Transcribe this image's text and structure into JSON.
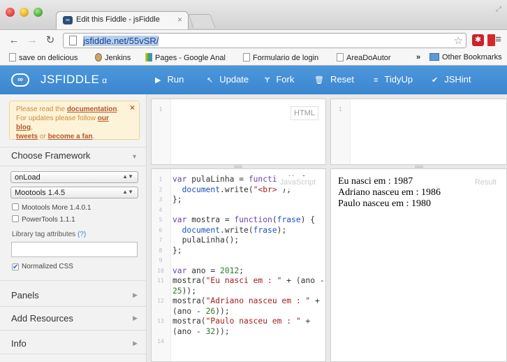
{
  "browser": {
    "tab_title": "Edit this Fiddle - jsFiddle",
    "tab_close": "×",
    "url_host": "jsfiddle.net",
    "url_path": "/55vSR/",
    "bookmarks": [
      "save on delicious",
      "Jenkins",
      "Pages - Google Anal",
      "Formulario de login",
      "AreaDoAutor"
    ],
    "bookmarks_overflow": "»",
    "other_bookmarks": "Other Bookmarks"
  },
  "header": {
    "logo": "JSFIDDLE",
    "logo_suffix": "α",
    "buttons": [
      {
        "label": "Run",
        "icon": "▶"
      },
      {
        "label": "Update",
        "icon": "↖"
      },
      {
        "label": "Fork",
        "icon": "Ɏ"
      },
      {
        "label": "Reset",
        "icon": "🗑"
      },
      {
        "label": "TidyUp",
        "icon": "≡"
      },
      {
        "label": "JSHint",
        "icon": "✔"
      }
    ]
  },
  "sidebar": {
    "notice": {
      "line1_pre": "Please read the ",
      "documentation": "documentation",
      "line1_post": ".",
      "line2_pre": "For updates please follow ",
      "our_blog": "our blog",
      "line2_post": ",",
      "tweets": "tweets",
      "or": " or ",
      "become_fan": "become a fan",
      "end": ".",
      "close": "×"
    },
    "choose_framework": "Choose Framework",
    "load_select": "onLoad",
    "framework_select": "Mootools 1.4.5",
    "checks": [
      {
        "label": "Mootools More 1.4.0.1",
        "checked": false
      },
      {
        "label": "PowerTools 1.1.1",
        "checked": false
      }
    ],
    "library_label": "Library tag attributes",
    "library_help": "(?)",
    "normalized_css": "Normalized CSS",
    "sections": [
      "Panels",
      "Add Resources",
      "Info"
    ]
  },
  "panels": {
    "html_label": "HTML",
    "js_label": "JavaScript",
    "result_label": "Result",
    "html_line": "1",
    "css_line": "1"
  },
  "code": {
    "lines": [
      "1",
      "2",
      "3",
      "4",
      "5",
      "6",
      "7",
      "8",
      "9",
      "10",
      "11",
      "",
      "12",
      "",
      "13",
      "",
      "14"
    ]
  },
  "result": {
    "lines": [
      "Eu nasci em : 1987",
      "Adriano nasceu em : 1986",
      "Paulo nasceu em : 1980"
    ]
  }
}
